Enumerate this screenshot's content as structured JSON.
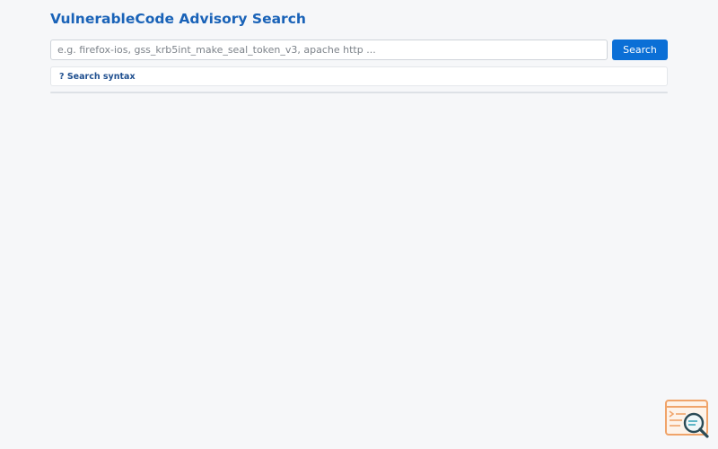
{
  "header": {
    "title": "VulnerableCode Advisory Search"
  },
  "search": {
    "placeholder": "e.g. firefox-ios, gss_krb5int_make_seal_token_v3, apache http ...",
    "value": "",
    "button_label": "Search"
  },
  "syntax": {
    "toggle_label": "? Search syntax"
  },
  "colors": {
    "accent": "#0b6fd6",
    "title": "#1a63b8",
    "background": "#f6f7f9"
  },
  "icons": {
    "corner_logo": "vulnerablecode-logo-icon"
  }
}
